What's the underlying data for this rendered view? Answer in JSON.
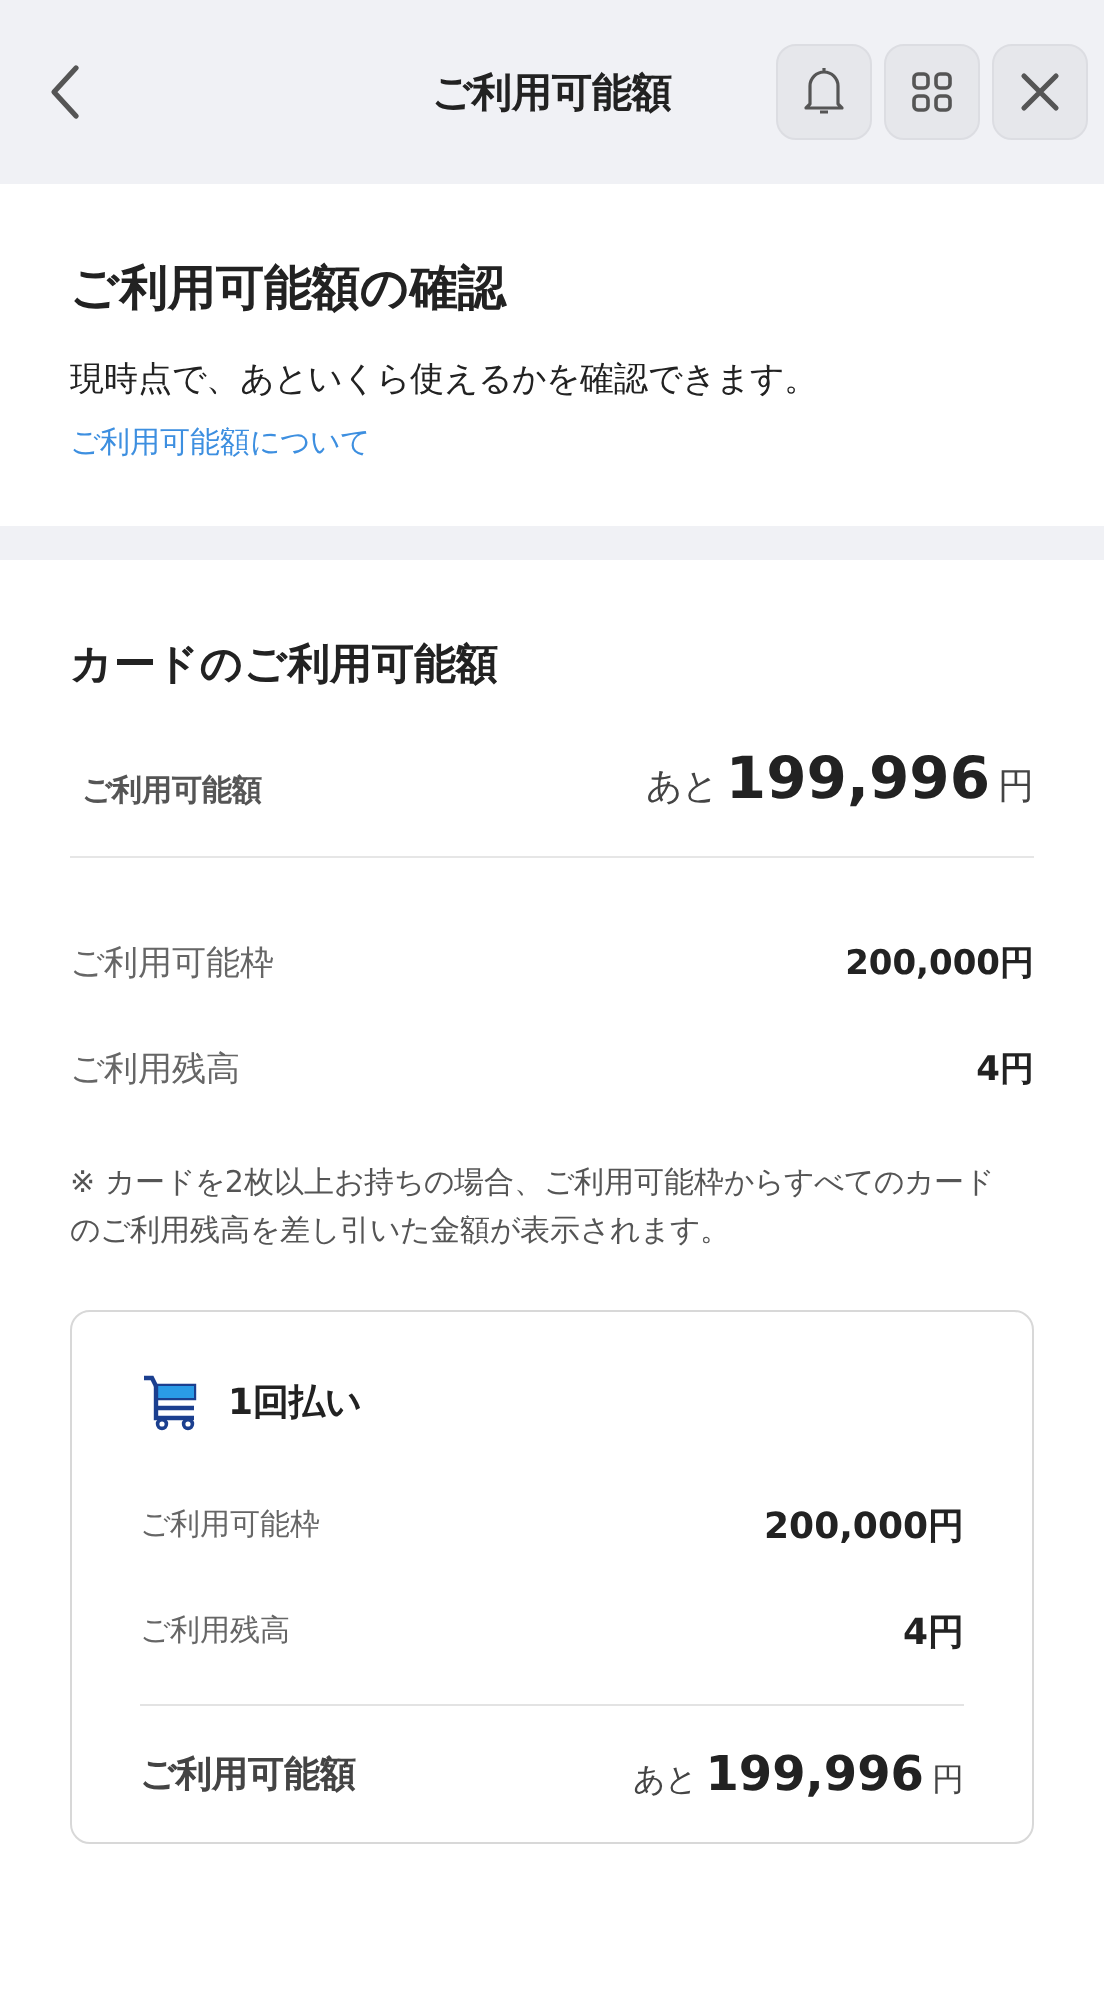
{
  "header": {
    "title": "ご利用可能額"
  },
  "intro": {
    "heading": "ご利用可能額の確認",
    "description": "現時点で、あといくら使えるかを確認できます。",
    "link": "ご利用可能額について"
  },
  "card_section": {
    "heading": "カードのご利用可能額",
    "total": {
      "label": "ご利用可能額",
      "prefix": "あと",
      "amount": "199,996",
      "unit": "円"
    },
    "rows": [
      {
        "label": "ご利用可能枠",
        "value": "200,000円"
      },
      {
        "label": "ご利用残高",
        "value": "4円"
      }
    ],
    "note": "※ カードを2枚以上お持ちの場合、ご利用可能枠からすべてのカードのご利用残高を差し引いた金額が表示されます。"
  },
  "payment_card": {
    "title": "1回払い",
    "rows": [
      {
        "label": "ご利用可能枠",
        "value": "200,000円"
      },
      {
        "label": "ご利用残高",
        "value": "4円"
      }
    ],
    "total": {
      "label": "ご利用可能額",
      "prefix": "あと",
      "amount": "199,996",
      "unit": "円"
    }
  }
}
